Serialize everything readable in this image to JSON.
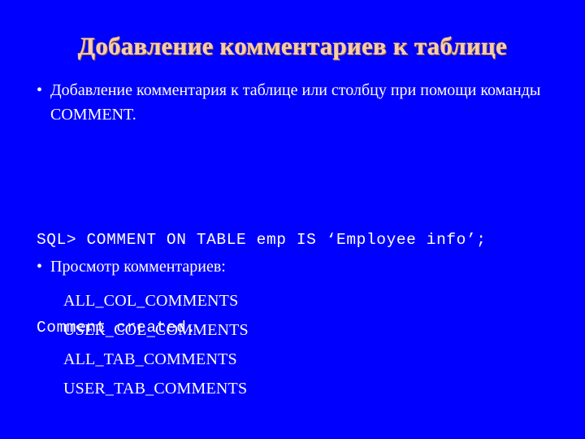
{
  "slide": {
    "title": "Добавление комментариев к таблице",
    "background_color": "#0000FF",
    "title_color": "#F7CDAA",
    "body_color": "#FFFFFF"
  },
  "bullets": [
    {
      "marker": "•",
      "text": "Добавление комментария к таблице или столбцу при помощи команды COMMENT."
    },
    {
      "marker": "•",
      "text": "Просмотр комментариев:"
    }
  ],
  "code": {
    "lines": [
      "SQL> COMMENT ON TABLE emp IS ‘Employee info’;",
      "Comment created."
    ]
  },
  "views": [
    "ALL_COL_COMMENTS",
    "USER_COL_COMMENTS",
    "ALL_TAB_COMMENTS",
    "USER_TAB_COMMENTS"
  ]
}
